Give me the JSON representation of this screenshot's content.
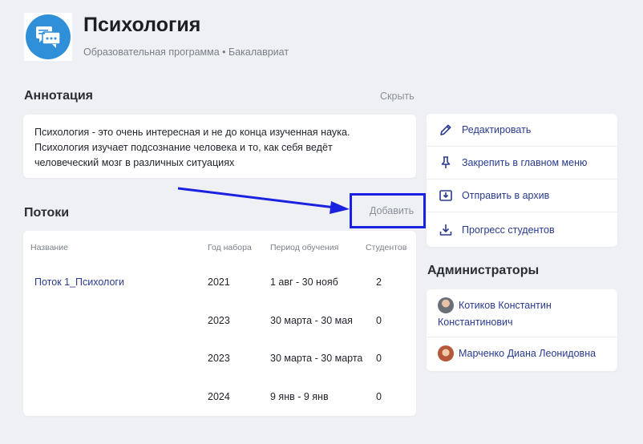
{
  "header": {
    "title": "Психология",
    "subtitle": "Образовательная программа • Бакалавриат",
    "icon": "chat-bubbles-icon",
    "icon_color": "#2f8fd8"
  },
  "annotation": {
    "heading": "Аннотация",
    "hide_label": "Скрыть",
    "lines": [
      "Психология - это очень интересная и не до конца изученная наука.",
      "Психология изучает подсознание человека и то, как себя ведёт",
      "человеческий мозг в различных ситуациях"
    ]
  },
  "streams": {
    "heading": "Потоки",
    "add_label": "Добавить",
    "columns": [
      "Название",
      "Год набора",
      "Период обучения",
      "Студентов"
    ],
    "rows": [
      {
        "name": "Поток 1_Психологи",
        "year": "2021",
        "period": "1 авг - 30 нояб",
        "students": "2"
      },
      {
        "name": "",
        "year": "2023",
        "period": "30 марта - 30 мая",
        "students": "0"
      },
      {
        "name": "",
        "year": "2023",
        "period": "30 марта - 30 марта",
        "students": "0"
      },
      {
        "name": "",
        "year": "2024",
        "period": "9 янв - 9 янв",
        "students": "0"
      }
    ]
  },
  "actions": [
    {
      "label": "Редактировать",
      "icon": "pencil-icon"
    },
    {
      "label": "Закрепить в главном меню",
      "icon": "pin-icon"
    },
    {
      "label": "Отправить в архив",
      "icon": "archive-icon"
    },
    {
      "label": "Прогресс студентов",
      "icon": "download-icon"
    }
  ],
  "admins": {
    "heading": "Администраторы",
    "people": [
      {
        "name_line1": "Котиков Константин",
        "name_line2": "Константинович"
      },
      {
        "name_line1": "Марченко Диана Леонидовна",
        "name_line2": ""
      }
    ]
  },
  "colors": {
    "accent_link": "#2a3a8f",
    "highlight_box": "#1b21e0",
    "background": "#eef0f4"
  }
}
